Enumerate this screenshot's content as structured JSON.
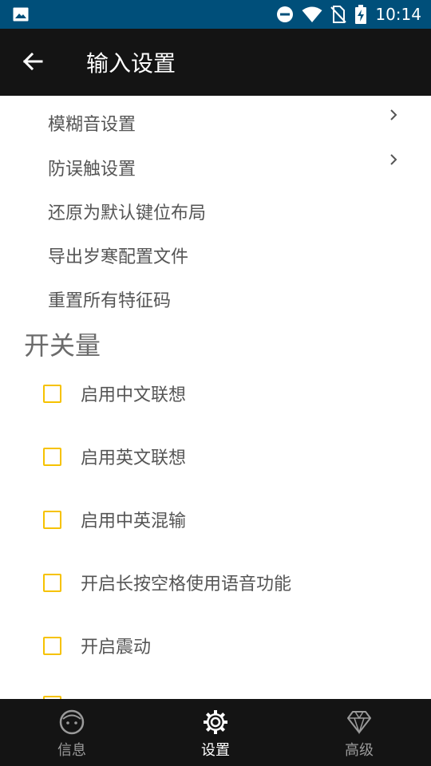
{
  "status_bar": {
    "time": "10:14"
  },
  "app_bar": {
    "title": "输入设置"
  },
  "settings_items": [
    {
      "label": "模糊音设置"
    },
    {
      "label": "防误触设置"
    },
    {
      "label": "还原为默认键位布局"
    },
    {
      "label": "导出岁寒配置文件"
    },
    {
      "label": "重置所有特征码"
    }
  ],
  "section_title": "开关量",
  "checkboxes": [
    {
      "label": "启用中文联想",
      "checked": false
    },
    {
      "label": "启用英文联想",
      "checked": false
    },
    {
      "label": "启用中英混输",
      "checked": false
    },
    {
      "label": "开启长按空格使用语音功能",
      "checked": false
    },
    {
      "label": "开启震动",
      "checked": false
    }
  ],
  "bottom_nav": [
    {
      "label": "信息",
      "icon": "face-icon",
      "active": false
    },
    {
      "label": "设置",
      "icon": "gear-icon",
      "active": true
    },
    {
      "label": "高级",
      "icon": "diamond-icon",
      "active": false
    }
  ],
  "colors": {
    "status_bar": "#004f7a",
    "app_bar": "#141414",
    "checkbox": "#f6c200"
  }
}
